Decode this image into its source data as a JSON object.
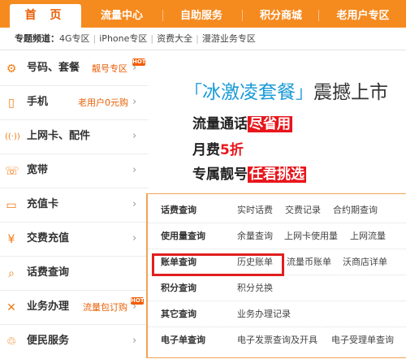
{
  "topnav": {
    "home": "首 页",
    "items": [
      "流量中心",
      "自助服务",
      "积分商城",
      "老用户专区"
    ]
  },
  "subnav": {
    "label": "专题频道：",
    "links": [
      "4G专区",
      "iPhone专区",
      "资费大全",
      "漫游业务专区"
    ]
  },
  "sidebar": {
    "items": [
      {
        "icon": "gear-icon",
        "label": "号码、套餐",
        "sub": "靓号专区",
        "hot": "HOT"
      },
      {
        "icon": "phone-icon",
        "label": "手机",
        "sub": "老用户0元购"
      },
      {
        "icon": "signal-icon",
        "label": "上网卡、配件",
        "sub": ""
      },
      {
        "icon": "broadband-icon",
        "label": "宽带",
        "sub": ""
      },
      {
        "icon": "card-icon",
        "label": "充值卡",
        "sub": ""
      },
      {
        "icon": "yen-icon",
        "label": "交费充值",
        "sub": ""
      },
      {
        "icon": "search-icon",
        "label": "话费查询",
        "sub": ""
      },
      {
        "icon": "tools-icon",
        "label": "业务办理",
        "sub": "流量包订购",
        "hot": "HOT"
      },
      {
        "icon": "service-icon",
        "label": "便民服务",
        "sub": ""
      }
    ]
  },
  "banner": {
    "headline": "冰激凌套餐",
    "headline_rest": "震撼上市",
    "line1": "流量通话",
    "line1_tag": "尽省用",
    "line2": "月费",
    "line2_red": "5折",
    "line3": "专属靓号",
    "line3_tag": "任君挑选"
  },
  "panel": {
    "rows": [
      {
        "head": "话费查询",
        "links": [
          "实时话费",
          "交费记录",
          "合约期查询"
        ]
      },
      {
        "head": "使用量查询",
        "links": [
          "余量查询",
          "上网卡使用量",
          "上网流量"
        ]
      },
      {
        "head": "账单查询",
        "links": [
          "历史账单",
          "流量币账单",
          "沃商店详单"
        ]
      },
      {
        "head": "积分查询",
        "links": [
          "积分兑换"
        ]
      },
      {
        "head": "其它查询",
        "links": [
          "业务办理记录"
        ]
      },
      {
        "head": "电子单查询",
        "links": [
          "电子发票查询及开具",
          "电子受理单查询"
        ]
      }
    ]
  },
  "colors": {
    "brand": "#f58a1f",
    "accent": "#e85e04",
    "highlight": "#e01f1f"
  }
}
